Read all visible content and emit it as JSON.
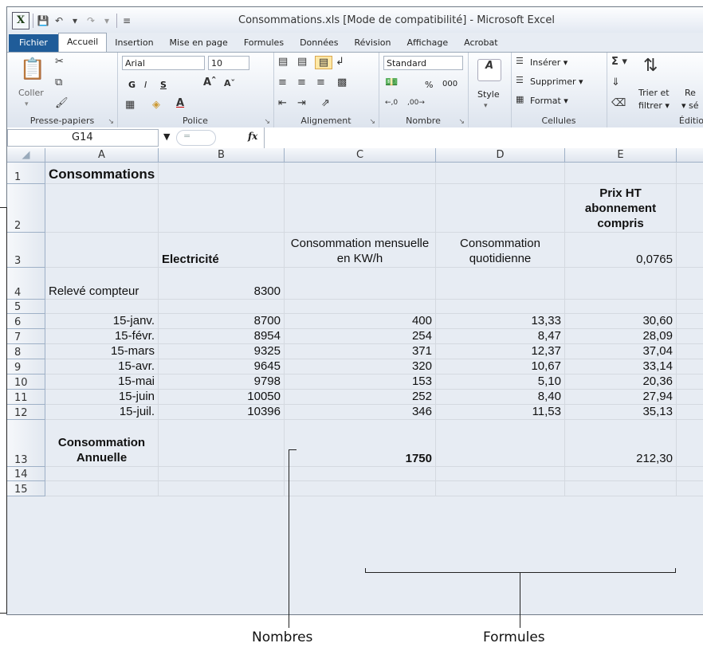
{
  "window": {
    "title": "Consommations.xls  [Mode de compatibilité]  -  Microsoft Excel"
  },
  "ribbon_tabs": [
    "Fichier",
    "Accueil",
    "Insertion",
    "Mise en page",
    "Formules",
    "Données",
    "Révision",
    "Affichage",
    "Acrobat"
  ],
  "ribbon": {
    "clipboard": {
      "paste": "Coller",
      "label": "Presse-papiers"
    },
    "font": {
      "name": "Arial",
      "size": "10",
      "bold": "G",
      "italic": "I",
      "underline": "S",
      "label": "Police"
    },
    "alignment": {
      "label": "Alignement"
    },
    "number": {
      "format": "Standard",
      "percent": "%",
      "thousands": "000",
      "label": "Nombre"
    },
    "styles": {
      "label": "Style"
    },
    "cells": {
      "insert": "Insérer",
      "delete": "Supprimer",
      "format": "Format",
      "label": "Cellules"
    },
    "editing": {
      "sort": "Trier et",
      "filter": "filtrer",
      "label": "Éditio",
      "r1": "Re",
      "r2": "sé"
    }
  },
  "formula_bar": {
    "cell_ref": "G14",
    "fx": "fx"
  },
  "columns": [
    "A",
    "B",
    "C",
    "D",
    "E"
  ],
  "rows": [
    "1",
    "2",
    "3",
    "4",
    "5",
    "6",
    "7",
    "8",
    "9",
    "10",
    "11",
    "12",
    "13",
    "14",
    "15"
  ],
  "cells": {
    "A1": "Consommations",
    "E2": "Prix HT abonnement compris",
    "B3": "Electricité",
    "C3": "Consommation mensuelle en KW/h",
    "D3": "Consommation quotidienne",
    "E3": "0,0765",
    "A4": "Relevé compteur",
    "B4": "8300",
    "data": [
      [
        "15-janv.",
        "8700",
        "400",
        "13,33",
        "30,60"
      ],
      [
        "15-févr.",
        "8954",
        "254",
        "8,47",
        "28,09"
      ],
      [
        "15-mars",
        "9325",
        "371",
        "12,37",
        "37,04"
      ],
      [
        "15-avr.",
        "9645",
        "320",
        "10,67",
        "33,14"
      ],
      [
        "15-mai",
        "9798",
        "153",
        "5,10",
        "20,36"
      ],
      [
        "15-juin",
        "10050",
        "252",
        "8,40",
        "27,94"
      ],
      [
        "15-juil.",
        "10396",
        "346",
        "11,53",
        "35,13"
      ]
    ],
    "A13": "Consommation Annuelle",
    "C13": "1750",
    "E13": "212,30"
  },
  "annotations": {
    "numbers": "Nombres",
    "formulas": "Formules"
  }
}
